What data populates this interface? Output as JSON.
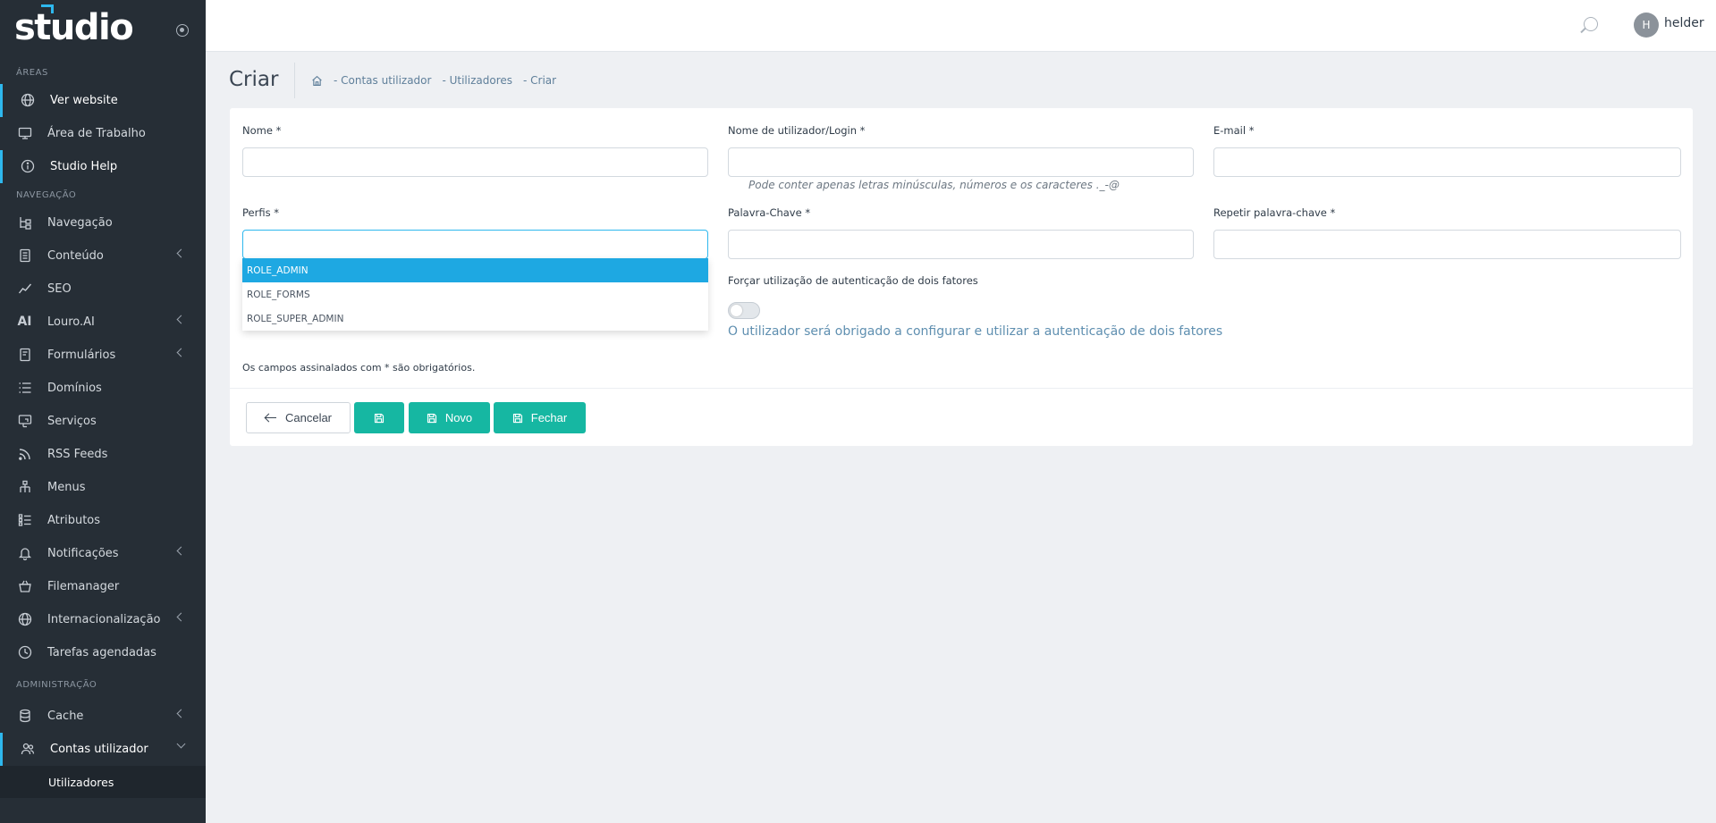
{
  "brand": {
    "name": "studio"
  },
  "sidebar": {
    "sections": {
      "areas": "ÁREAS",
      "navigation": "NAVEGAÇÃO",
      "administration": "ADMINISTRAÇÃO"
    },
    "areas_items": [
      {
        "label": "Ver website",
        "icon": "globe-icon",
        "active": true
      },
      {
        "label": "Área de Trabalho",
        "icon": "monitor-icon"
      },
      {
        "label": "Studio Help",
        "icon": "info-icon",
        "active": true
      }
    ],
    "nav_items": [
      {
        "label": "Navegação",
        "icon": "hierarchy-icon"
      },
      {
        "label": "Conteúdo",
        "icon": "document-icon",
        "expandable": true
      },
      {
        "label": "SEO",
        "icon": "chart-line-icon"
      },
      {
        "label": "Louro.AI",
        "icon": "ai-icon",
        "expandable": true
      },
      {
        "label": "Formulários",
        "icon": "form-icon",
        "expandable": true
      },
      {
        "label": "Domínios",
        "icon": "list-icon"
      },
      {
        "label": "Serviços",
        "icon": "services-icon"
      },
      {
        "label": "RSS Feeds",
        "icon": "rss-icon"
      },
      {
        "label": "Menus",
        "icon": "sitemap-icon"
      },
      {
        "label": "Atributos",
        "icon": "attributes-icon"
      },
      {
        "label": "Notificações",
        "icon": "bell-icon",
        "expandable": true
      },
      {
        "label": "Filemanager",
        "icon": "basket-icon"
      },
      {
        "label": "Internacionalização",
        "icon": "globe-icon",
        "expandable": true
      },
      {
        "label": "Tarefas agendadas",
        "icon": "clock-icon"
      }
    ],
    "admin_items": [
      {
        "label": "Cache",
        "icon": "database-icon",
        "expandable": true
      },
      {
        "label": "Contas utilizador",
        "icon": "users-icon",
        "expanded": true,
        "active": true
      }
    ],
    "sub_items": [
      {
        "label": "Utilizadores"
      }
    ]
  },
  "topbar": {
    "user_initial": "H",
    "username": "helder"
  },
  "page": {
    "title": "Criar",
    "breadcrumb": [
      "- Contas utilizador",
      "- Utilizadores",
      "- Criar"
    ]
  },
  "form": {
    "name_label": "Nome *",
    "name_value": "",
    "login_label": "Nome de utilizador/Login *",
    "login_value": "",
    "login_hint": "Pode conter apenas letras minúsculas, números e os caracteres ._-@",
    "email_label": "E-mail *",
    "email_value": "",
    "profiles_label": "Perfis *",
    "profiles_value": "",
    "profile_options": [
      "ROLE_ADMIN",
      "ROLE_FORMS",
      "ROLE_SUPER_ADMIN"
    ],
    "profile_selected_index": 0,
    "password_label": "Palavra-Chave *",
    "repeat_password_label": "Repetir palavra-chave *",
    "two_factor_label": "Forçar utilização de autenticação de dois fatores",
    "two_factor_enabled": false,
    "two_factor_desc": "O utilizador será obrigado a configurar e utilizar a autenticação de dois fatores",
    "required_note": "Os campos assinalados com * são obrigatórios."
  },
  "buttons": {
    "cancel": "Cancelar",
    "new": "Novo",
    "close": "Fechar"
  },
  "colors": {
    "sidebar_bg": "#262e36",
    "accent_blue": "#2eb8ee",
    "dropdown_selected": "#1ea8e2",
    "button_teal": "#16b7a2"
  }
}
